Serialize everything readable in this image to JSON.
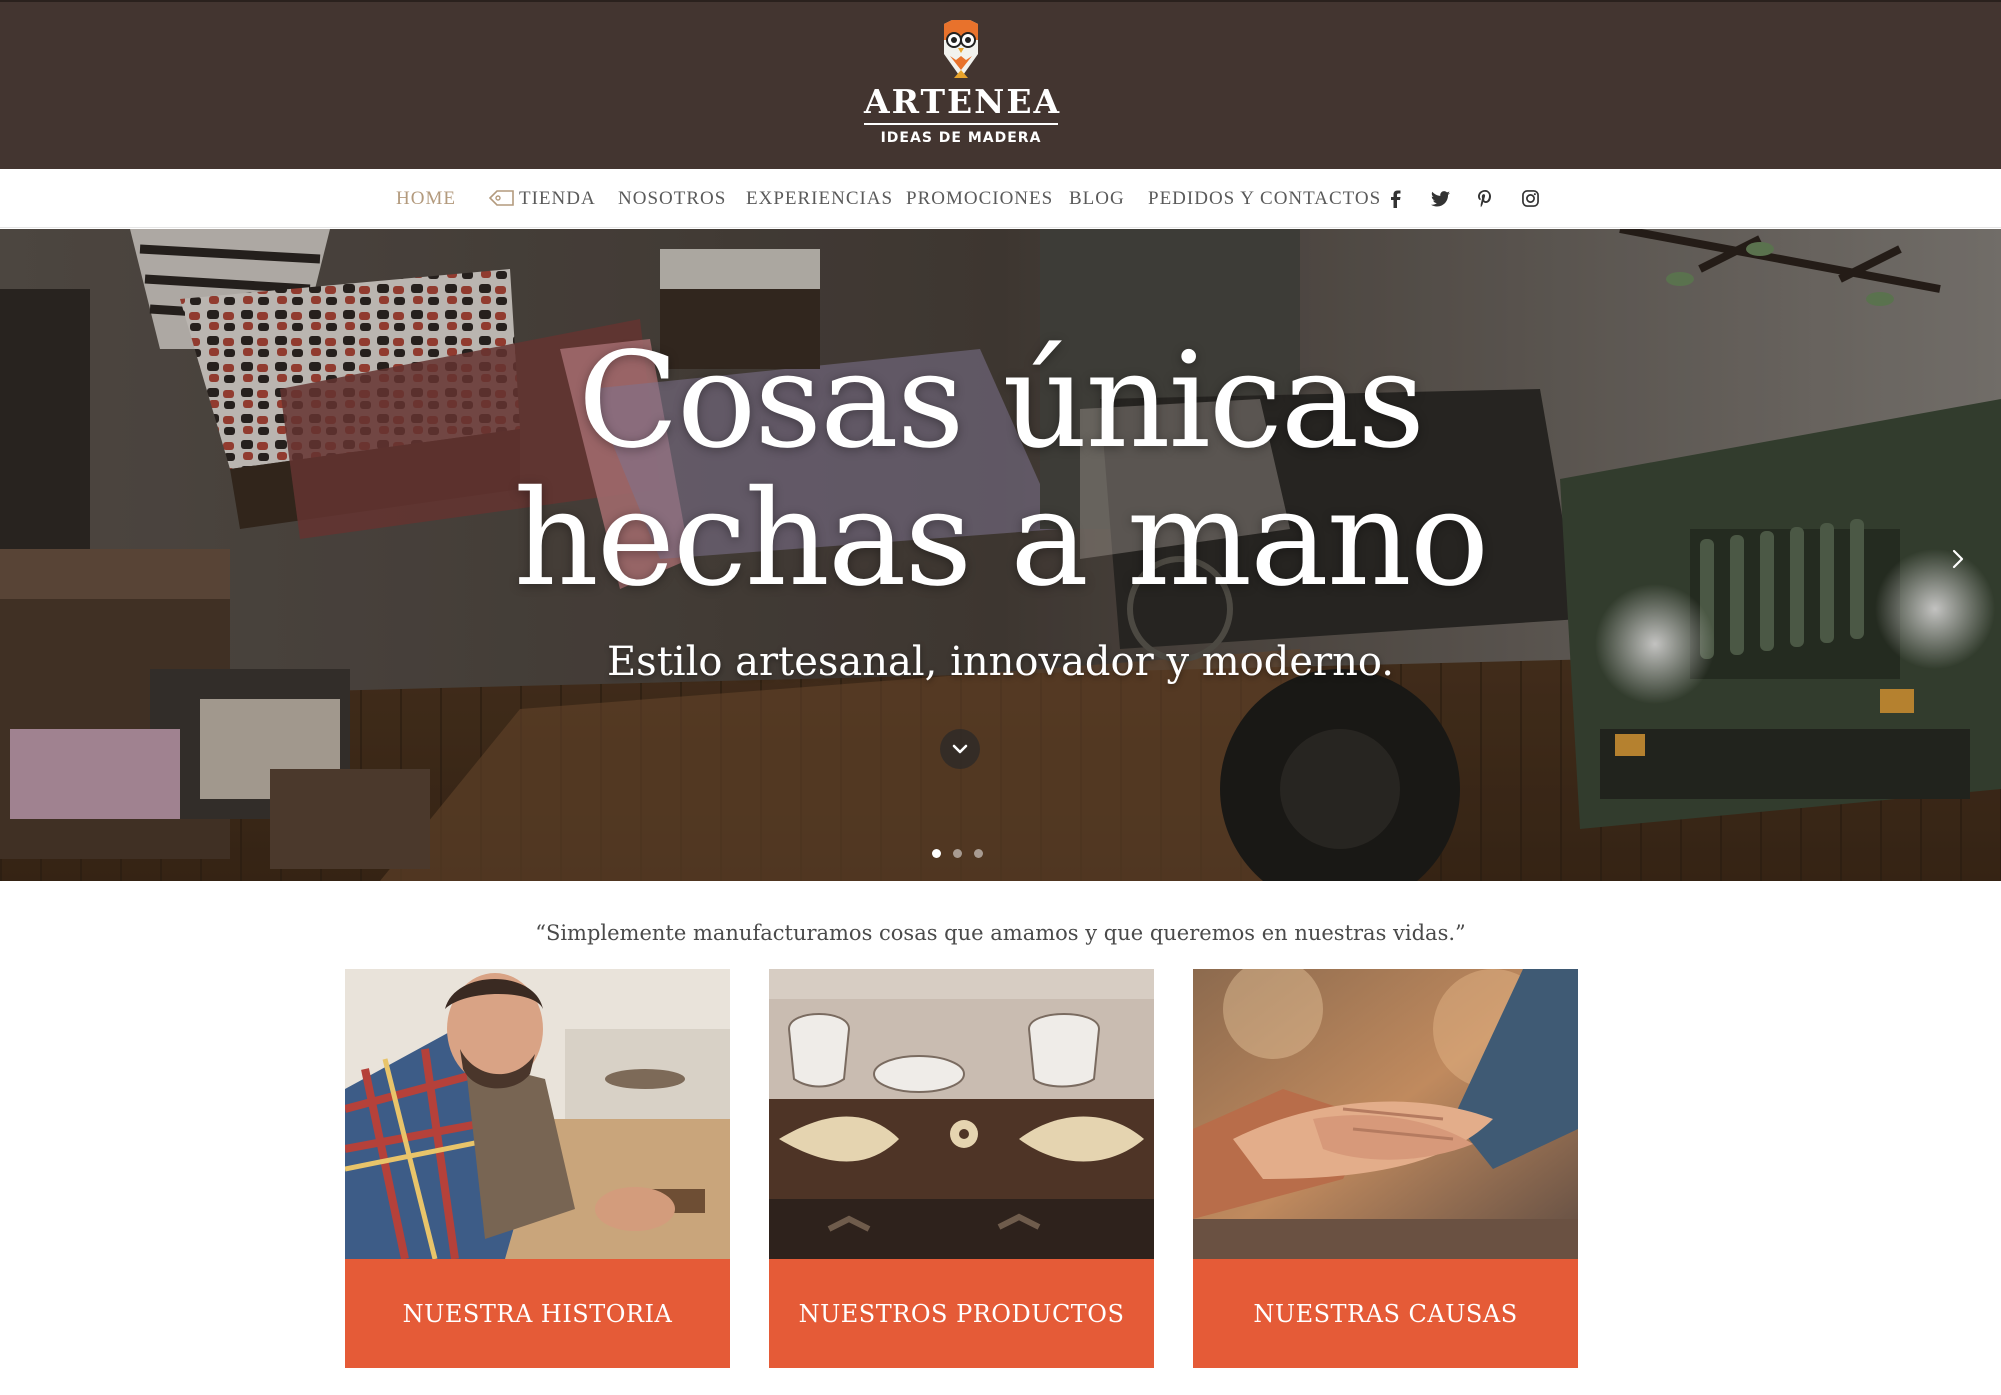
{
  "brand": {
    "name": "ARTENEA",
    "tagline": "IDEAS DE MADERA"
  },
  "nav": {
    "items": [
      {
        "label": "HOME"
      },
      {
        "label": "TIENDA"
      },
      {
        "label": "NOSOTROS"
      },
      {
        "label": "EXPERIENCIAS"
      },
      {
        "label": "PROMOCIONES"
      },
      {
        "label": "BLOG"
      },
      {
        "label": "PEDIDOS Y CONTACTOS"
      }
    ],
    "social": [
      "facebook-icon",
      "twitter-icon",
      "pinterest-icon",
      "instagram-icon"
    ]
  },
  "hero": {
    "title_line1": "Cosas únicas",
    "title_line2": "hechas a mano",
    "subtitle": "Estilo artesanal, innovador y moderno.",
    "slides": 3,
    "active_slide": 1
  },
  "quote": "“Simplemente manufacturamos cosas que amamos y que queremos en nuestras vidas.”",
  "cards": [
    {
      "label": "NUESTRA HISTORIA"
    },
    {
      "label": "NUESTROS PRODUCTOS"
    },
    {
      "label": "NUESTRAS CAUSAS"
    }
  ],
  "colors": {
    "header_bg": "#433530",
    "nav_active": "#b39a7d",
    "accent": "#e55b37"
  }
}
